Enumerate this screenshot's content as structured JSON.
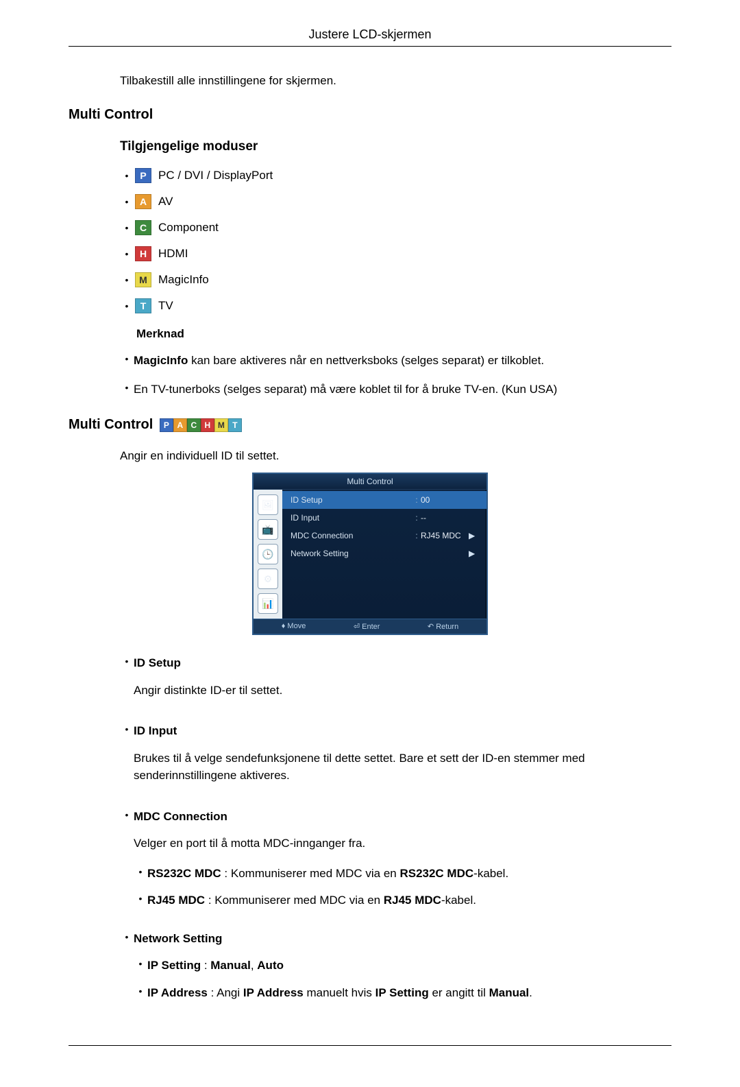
{
  "header": {
    "title": "Justere LCD-skjermen"
  },
  "intro": "Tilbakestill alle innstillingene for skjermen.",
  "multi_control_heading": "Multi Control",
  "available_modes_heading": "Tilgjengelige moduser",
  "modes": [
    {
      "letter": "P",
      "cls": "p",
      "label": "PC / DVI / DisplayPort"
    },
    {
      "letter": "A",
      "cls": "a",
      "label": "AV"
    },
    {
      "letter": "C",
      "cls": "c",
      "label": "Component"
    },
    {
      "letter": "H",
      "cls": "h",
      "label": "HDMI"
    },
    {
      "letter": "M",
      "cls": "m",
      "label": "MagicInfo"
    },
    {
      "letter": "T",
      "cls": "t",
      "label": "TV"
    }
  ],
  "note_heading": "Merknad",
  "notes": [
    {
      "bold": "MagicInfo",
      "rest": " kan bare aktiveres når en nettverksboks (selges separat) er tilkoblet."
    },
    {
      "bold": "",
      "rest": "En TV-tunerboks (selges separat) må være koblet til for å bruke TV-en. (Kun USA)"
    }
  ],
  "multi_control2_heading": "Multi Control",
  "multi_control2_desc": "Angir en individuell ID til settet.",
  "osd": {
    "title": "Multi Control",
    "rows": [
      {
        "label": "ID Setup",
        "value": "00",
        "arrow": false,
        "selected": true
      },
      {
        "label": "ID Input",
        "value": "--",
        "arrow": false,
        "selected": false
      },
      {
        "label": "MDC Connection",
        "value": "RJ45 MDC",
        "arrow": true,
        "selected": false
      },
      {
        "label": "Network Setting",
        "value": "",
        "arrow": true,
        "selected": false
      }
    ],
    "footer": {
      "move": "Move",
      "enter": "Enter",
      "ret": "Return"
    }
  },
  "details": {
    "id_setup": {
      "title": "ID Setup",
      "desc": "Angir distinkte ID-er til settet."
    },
    "id_input": {
      "title": "ID Input",
      "desc": "Brukes til å velge sendefunksjonene til dette settet. Bare et sett der ID-en stemmer med senderinnstillingene aktiveres."
    },
    "mdc": {
      "title": "MDC Connection",
      "desc": "Velger en port til å motta MDC-innganger fra.",
      "sub": [
        {
          "b1": "RS232C MDC",
          "mid": " : Kommuniserer med MDC via en ",
          "b2": "RS232C MDC",
          "tail": "-kabel."
        },
        {
          "b1": "RJ45 MDC",
          "mid": " : Kommuniserer med MDC via en ",
          "b2": "RJ45 MDC",
          "tail": "-kabel."
        }
      ]
    },
    "net": {
      "title": "Network Setting",
      "sub": [
        {
          "b1": "IP Setting",
          "mid": " : ",
          "b2": "Manual",
          "sep": ", ",
          "b3": "Auto"
        },
        {
          "b1": "IP Address",
          "mid": " : Angi ",
          "b2": "IP Address",
          "mid2": " manuelt hvis ",
          "b3": "IP Setting",
          "mid3": " er angitt til ",
          "b4": "Manual",
          "tail": "."
        }
      ]
    }
  }
}
